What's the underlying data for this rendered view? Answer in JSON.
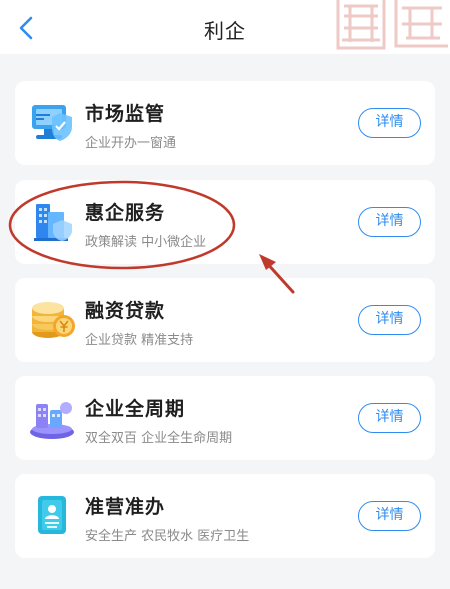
{
  "header": {
    "title": "利企"
  },
  "cards": [
    {
      "title": "市场监管",
      "subtitle": "企业开办一窗通",
      "button": "详情",
      "icon": "monitor-shield-icon"
    },
    {
      "title": "惠企服务",
      "subtitle": "政策解读 中小微企业",
      "button": "详情",
      "icon": "building-shield-icon"
    },
    {
      "title": "融资贷款",
      "subtitle": "企业贷款 精准支持",
      "button": "详情",
      "icon": "coins-icon"
    },
    {
      "title": "企业全周期",
      "subtitle": "双全双百 企业全生命周期",
      "button": "详情",
      "icon": "factory-cycle-icon"
    },
    {
      "title": "准营准办",
      "subtitle": "安全生产 农民牧水 医疗卫生",
      "button": "详情",
      "icon": "license-id-icon"
    }
  ],
  "colors": {
    "accent": "#2f8cf0",
    "annotation": "#c0392b",
    "background": "#f4f5f7"
  }
}
